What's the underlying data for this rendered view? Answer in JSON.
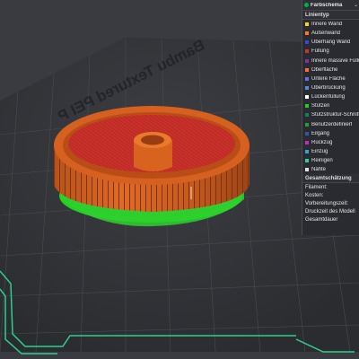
{
  "bed": {
    "label": "Bambu Textured PEI P"
  },
  "panel": {
    "dropdown_label": "Farbschema",
    "line_types_header": "Linientyp",
    "line_types": [
      {
        "label": "Innere Wand",
        "color": "#f5d22a"
      },
      {
        "label": "Außenwand",
        "color": "#ff7a1a"
      },
      {
        "label": "Überhang Wand",
        "color": "#3b48d6"
      },
      {
        "label": "Füllung",
        "color": "#c8352a"
      },
      {
        "label": "Innere massive Füllung",
        "color": "#8a2fa0"
      },
      {
        "label": "Oberfläche",
        "color": "#ff6a3d"
      },
      {
        "label": "Untere Fläche",
        "color": "#6b6ad6"
      },
      {
        "label": "Überbrückung",
        "color": "#5a8ad0"
      },
      {
        "label": "Lückenfüllung",
        "color": "#ffffff"
      },
      {
        "label": "Stützen",
        "color": "#1fcf1f"
      },
      {
        "label": "Stützstruktur-Schnittstelle",
        "color": "#11805a"
      },
      {
        "label": "Benutzerdefiniert",
        "color": "#2e9a2e"
      },
      {
        "label": "Eilgang",
        "color": "#2f5aa0"
      },
      {
        "label": "Rückzug",
        "color": "#c02ac0"
      },
      {
        "label": "Einzug",
        "color": "#2fa8d0"
      },
      {
        "label": "Reinigen",
        "color": "#2ad0a8"
      },
      {
        "label": "Nähte",
        "color": "#e0e0e0"
      }
    ],
    "estimate_header": "Gesamtschätzung",
    "estimates": [
      {
        "label": "Filament:"
      },
      {
        "label": "Kosten:"
      },
      {
        "label": "Vorbereitungszeit:"
      },
      {
        "label": "Druckzeit des Modell"
      },
      {
        "label": "Gesamtdauer"
      }
    ]
  }
}
